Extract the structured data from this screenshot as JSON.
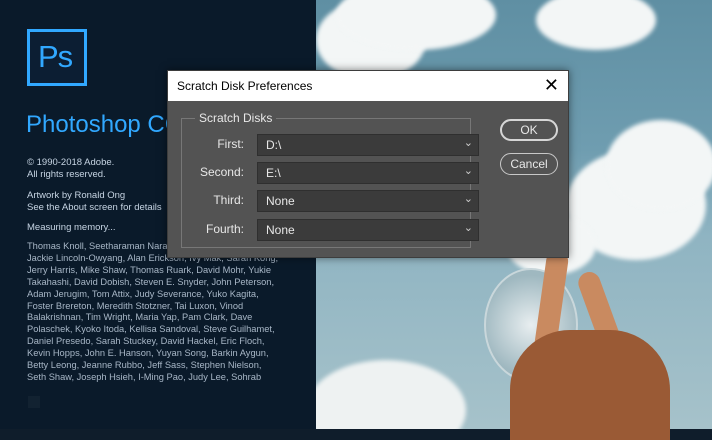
{
  "splash": {
    "logo_text": "Ps",
    "app_name": "Photoshop CC",
    "copyright_line1": "© 1990-2018 Adobe.",
    "copyright_line2": "All rights reserved.",
    "artwork_line1": "Artwork by Ronald Ong",
    "artwork_line2": "See the About screen for details",
    "status": "Measuring memory...",
    "credits": [
      "Thomas Knoll, Seetharaman Narayanan,",
      "Jackie Lincoln-Owyang, Alan Erickson, Ivy Mak, Sarah Kong,",
      "Jerry Harris, Mike Shaw, Thomas Ruark, David Mohr, Yukie",
      "Takahashi, David Dobish, Steven E. Snyder, John Peterson,",
      "Adam Jerugim, Tom Attix, Judy Severance, Yuko Kagita,",
      "Foster Brereton, Meredith Stotzner, Tai Luxon, Vinod",
      "Balakrishnan, Tim Wright, Maria Yap, Pam Clark, Dave",
      "Polaschek, Kyoko Itoda, Kellisa Sandoval, Steve Guilhamet,",
      "Daniel Presedo, Sarah Stuckey, David Hackel, Eric Floch,",
      "Kevin Hopps, John E. Hanson, Yuyan Song, Barkin Aygun,",
      "Betty Leong, Jeanne Rubbo, Jeff Sass, Stephen Nielson,",
      "Seth Shaw, Joseph Hsieh, I-Ming Pao, Judy Lee, Sohrab"
    ]
  },
  "dialog": {
    "title": "Scratch Disk Preferences",
    "close_glyph": "✕",
    "group_title": "Scratch Disks",
    "rows": [
      {
        "label": "First:",
        "value": "D:\\"
      },
      {
        "label": "Second:",
        "value": "E:\\"
      },
      {
        "label": "Third:",
        "value": "None"
      },
      {
        "label": "Fourth:",
        "value": "None"
      }
    ],
    "ok_label": "OK",
    "cancel_label": "Cancel",
    "chevron_glyph": "⌄"
  },
  "colors": {
    "accent": "#31a8ff",
    "dialog_bg": "#535353",
    "select_bg": "#3b3b3b"
  }
}
